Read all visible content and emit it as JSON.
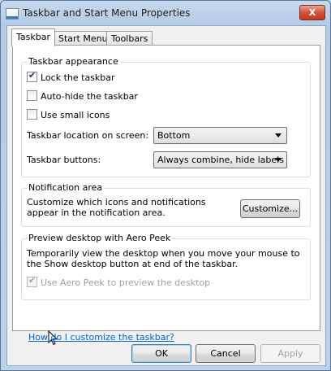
{
  "window": {
    "title": "Taskbar and Start Menu Properties",
    "close_label": "X"
  },
  "tabs": [
    {
      "label": "Taskbar",
      "active": true
    },
    {
      "label": "Start Menu",
      "active": false
    },
    {
      "label": "Toolbars",
      "active": false
    }
  ],
  "appearance": {
    "legend": "Taskbar appearance",
    "lock_label": "Lock the taskbar",
    "lock_checked": true,
    "autohide_label": "Auto-hide the taskbar",
    "autohide_checked": false,
    "small_icons_label": "Use small icons",
    "small_icons_checked": false,
    "location_label": "Taskbar location on screen:",
    "location_value": "Bottom",
    "buttons_label": "Taskbar buttons:",
    "buttons_value": "Always combine, hide labels"
  },
  "notification": {
    "legend": "Notification area",
    "description": "Customize which icons and notifications appear in the notification area.",
    "customize_label": "Customize..."
  },
  "aero_peek": {
    "legend": "Preview desktop with Aero Peek",
    "description": "Temporarily view the desktop when you move your mouse to the Show desktop button at end of the taskbar.",
    "use_label": "Use Aero Peek to preview the desktop",
    "use_checked": true,
    "use_enabled": false
  },
  "help_link": "How do I customize the taskbar?",
  "buttons": {
    "ok": "OK",
    "cancel": "Cancel",
    "apply": "Apply"
  },
  "colors": {
    "title_bar": "#b9d1ea",
    "link": "#0066cc",
    "close_button": "#c1391f"
  }
}
